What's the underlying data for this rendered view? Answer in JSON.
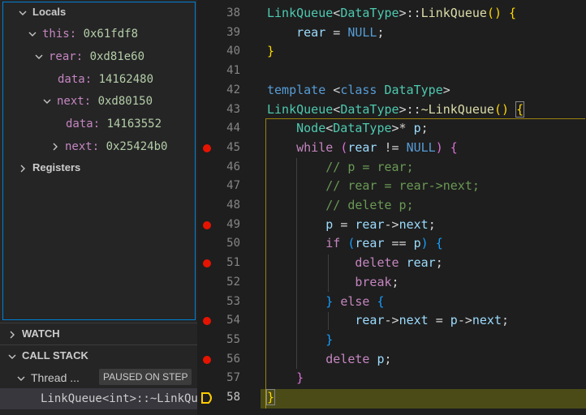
{
  "sidebar": {
    "variables": {
      "locals_label": "Locals",
      "rows": [
        {
          "name": "this",
          "value": "0x61fdf8"
        },
        {
          "name": "rear",
          "value": "0xd81e60"
        },
        {
          "name": "data",
          "value": "14162480"
        },
        {
          "name": "next",
          "value": "0xd80150"
        },
        {
          "name": "data",
          "value": "14163552"
        },
        {
          "name": "next",
          "value": "0x25424b0"
        }
      ],
      "registers_label": "Registers"
    },
    "watch_label": "WATCH",
    "call_stack": {
      "label": "CALL STACK",
      "thread_label": "Thread ...",
      "status_badge": "PAUSED ON STEP",
      "frame": "LinkQueue<int>::~LinkQueue"
    }
  },
  "editor": {
    "line_numbers": [
      "38",
      "39",
      "40",
      "41",
      "42",
      "43",
      "44",
      "45",
      "46",
      "47",
      "48",
      "49",
      "50",
      "51",
      "52",
      "53",
      "54",
      "55",
      "56",
      "57",
      "58"
    ],
    "current_line": "58",
    "breakpoint_lines": [
      "45",
      "49",
      "51",
      "54",
      "56"
    ],
    "tokens": {
      "linkqueue": "LinkQueue",
      "datatype": "DataType",
      "node": "Node",
      "rear": "rear",
      "next": "next",
      "null": "NULL",
      "template": "template",
      "class": "class",
      "while": "while",
      "if": "if",
      "else": "else",
      "delete": "delete",
      "break": "break",
      "p": "p",
      "dtor": "~LinkQueue",
      "comment1": "// p = rear;",
      "comment2": "// rear = rear->next;",
      "comment3": "// delete p;"
    }
  },
  "colors": {
    "accent_border": "#007fd4",
    "breakpoint": "#e51400",
    "current_line_bg": "#4b4b18",
    "debug_arrow": "#ffcc00"
  },
  "icons": {
    "chevron_down": "chevron-down-icon",
    "chevron_right": "chevron-right-icon",
    "breakpoint": "breakpoint-icon",
    "debug_pointer": "debug-stackframe-icon"
  }
}
